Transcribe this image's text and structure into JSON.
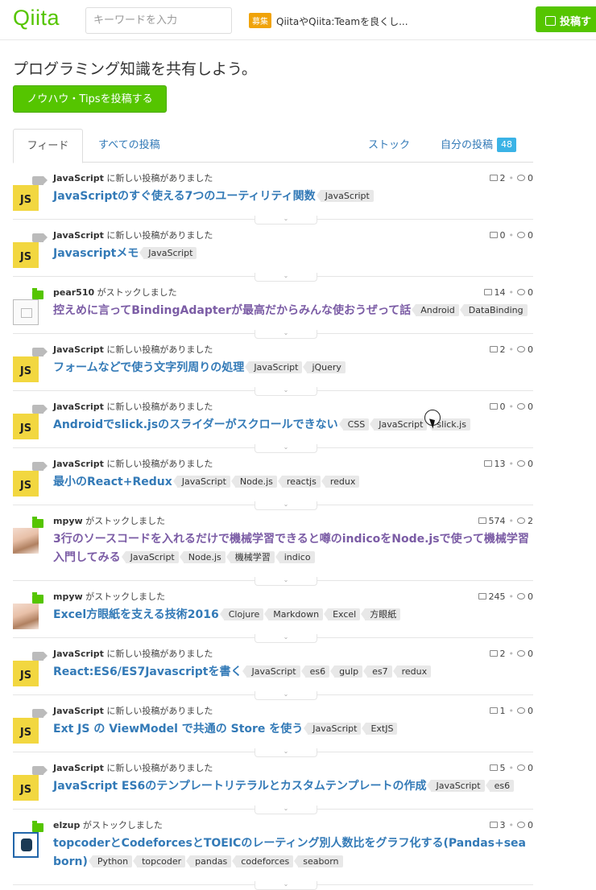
{
  "header": {
    "logo": "Qiita",
    "search_placeholder": "キーワードを入力",
    "recruit_badge": "募集",
    "recruit_text": "QiitaやQiita:Teamを良くし...",
    "post_button": "投稿す"
  },
  "intro": {
    "tagline": "プログラミング知識を共有しよう。",
    "knowhow_button": "ノウハウ・Tipsを投稿する"
  },
  "tabs": {
    "feed": "フィード",
    "all": "すべての投稿",
    "stock": "ストック",
    "mine": "自分の投稿",
    "mine_count": "48"
  },
  "feed": [
    {
      "actor": "JavaScript",
      "action": "に新しい投稿がありました",
      "title": "JavaScriptのすぐ使える7つのユーティリティ関数",
      "tags": [
        "JavaScript"
      ],
      "stocks": "2",
      "comments": "0",
      "avatar": "js",
      "mark": "tag",
      "visited": false
    },
    {
      "actor": "JavaScript",
      "action": "に新しい投稿がありました",
      "title": "Javascriptメモ",
      "tags": [
        "JavaScript"
      ],
      "stocks": "0",
      "comments": "0",
      "avatar": "js",
      "mark": "tag",
      "visited": false
    },
    {
      "actor": "pear510",
      "action": "がストックしました",
      "title": "控えめに言ってBindingAdapterが最高だからみんな使おうぜって話",
      "tags": [
        "Android",
        "DataBinding"
      ],
      "stocks": "14",
      "comments": "0",
      "avatar": "image",
      "mark": "folder",
      "visited": true
    },
    {
      "actor": "JavaScript",
      "action": "に新しい投稿がありました",
      "title": "フォームなどで使う文字列周りの処理",
      "tags": [
        "JavaScript",
        "jQuery"
      ],
      "stocks": "2",
      "comments": "0",
      "avatar": "js",
      "mark": "tag",
      "visited": false
    },
    {
      "actor": "JavaScript",
      "action": "に新しい投稿がありました",
      "title": "Androidでslick.jsのスライダーがスクロールできない",
      "tags": [
        "CSS",
        "JavaScript",
        "slick.js"
      ],
      "stocks": "0",
      "comments": "0",
      "avatar": "js",
      "mark": "tag",
      "visited": false
    },
    {
      "actor": "JavaScript",
      "action": "に新しい投稿がありました",
      "title": "最小のReact+Redux",
      "tags": [
        "JavaScript",
        "Node.js",
        "reactjs",
        "redux"
      ],
      "stocks": "13",
      "comments": "0",
      "avatar": "js",
      "mark": "tag",
      "visited": false
    },
    {
      "actor": "mpyw",
      "action": "がストックしました",
      "title": "3行のソースコードを入れるだけで機械学習できると噂のindicoをNode.jsで使って機械学習入門してみる",
      "tags": [
        "JavaScript",
        "Node.js",
        "機械学習",
        "indico"
      ],
      "stocks": "574",
      "comments": "2",
      "avatar": "anime",
      "mark": "folder",
      "visited": true
    },
    {
      "actor": "mpyw",
      "action": "がストックしました",
      "title": "Excel方眼紙を支える技術2016",
      "tags": [
        "Clojure",
        "Markdown",
        "Excel",
        "方眼紙"
      ],
      "stocks": "245",
      "comments": "0",
      "avatar": "anime",
      "mark": "folder",
      "visited": false
    },
    {
      "actor": "JavaScript",
      "action": "に新しい投稿がありました",
      "title": "React:ES6/ES7Javascriptを書く",
      "tags": [
        "JavaScript",
        "es6",
        "gulp",
        "es7",
        "redux"
      ],
      "stocks": "2",
      "comments": "0",
      "avatar": "js",
      "mark": "tag",
      "visited": false
    },
    {
      "actor": "JavaScript",
      "action": "に新しい投稿がありました",
      "title": "Ext JS の ViewModel で共通の Store を使う",
      "tags": [
        "JavaScript",
        "ExtJS"
      ],
      "stocks": "1",
      "comments": "0",
      "avatar": "js",
      "mark": "tag",
      "visited": false
    },
    {
      "actor": "JavaScript",
      "action": "に新しい投稿がありました",
      "title": "JavaScript ES6のテンプレートリテラルとカスタムテンプレートの作成",
      "tags": [
        "JavaScript",
        "es6"
      ],
      "stocks": "5",
      "comments": "0",
      "avatar": "js",
      "mark": "tag",
      "visited": false
    },
    {
      "actor": "elzup",
      "action": "がストックしました",
      "title": "topcoderとCodeforcesとTOEICのレーティング別人数比をグラフ化する(Pandas+seaborn)",
      "tags": [
        "Python",
        "topcoder",
        "pandas",
        "codeforces",
        "seaborn"
      ],
      "stocks": "3",
      "comments": "0",
      "avatar": "pixel",
      "mark": "folder",
      "visited": false
    }
  ],
  "js_avatar_text": "JS",
  "chevron": "»"
}
